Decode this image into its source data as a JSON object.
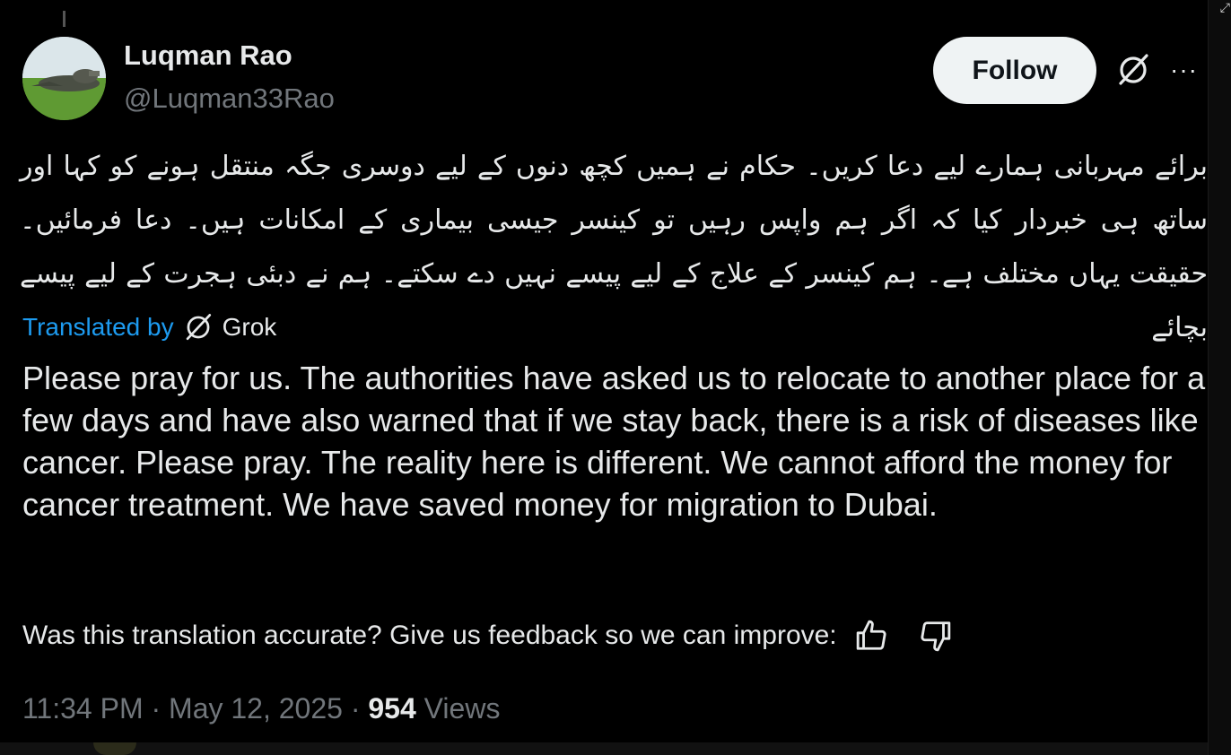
{
  "author": {
    "name": "Luqman Rao",
    "handle": "@Luqman33Rao"
  },
  "actions": {
    "follow_label": "Follow",
    "more_label": "···"
  },
  "post": {
    "original_text": "برائے مہربانی ہمارے لیے دعا کریں۔ حکام نے ہمیں کچھ دنوں کے لیے دوسری جگہ منتقل ہونے کو کہا اور ساتھ ہی خبردار کیا کہ اگر ہم واپس رہیں تو کینسر جیسی بیماری کے امکانات ہیں۔ دعا فرمائیں۔ حقیقت یہاں مختلف ہے۔ ہم کینسر کے علاج کے لیے پیسے نہیں دے سکتے۔ ہم نے دبئی ہجرت کے لیے پیسے بچائے",
    "translated_by_label": "Translated by",
    "translator_name": "Grok",
    "translation": "Please pray for us. The authorities have asked us to relocate to another place for a few days and have also warned that if we stay back, there is a risk of diseases like cancer. Please pray. The reality here is different. We cannot afford the money for cancer treatment. We have saved money for migration to Dubai.",
    "feedback_prompt": "Was this translation accurate? Give us feedback so we can improve:",
    "time": "11:34 PM",
    "separator": "·",
    "date": "May 12, 2025",
    "views_count": "954",
    "views_label": "Views"
  },
  "icons": {
    "grok": "grok-icon",
    "more": "more-icon",
    "thumbs_up": "thumbs-up-icon",
    "thumbs_down": "thumbs-down-icon"
  },
  "colors": {
    "background": "#000000",
    "text": "#e7e9ea",
    "muted": "#71767b",
    "link": "#1d9bf0",
    "follow_bg": "#eff3f4"
  }
}
